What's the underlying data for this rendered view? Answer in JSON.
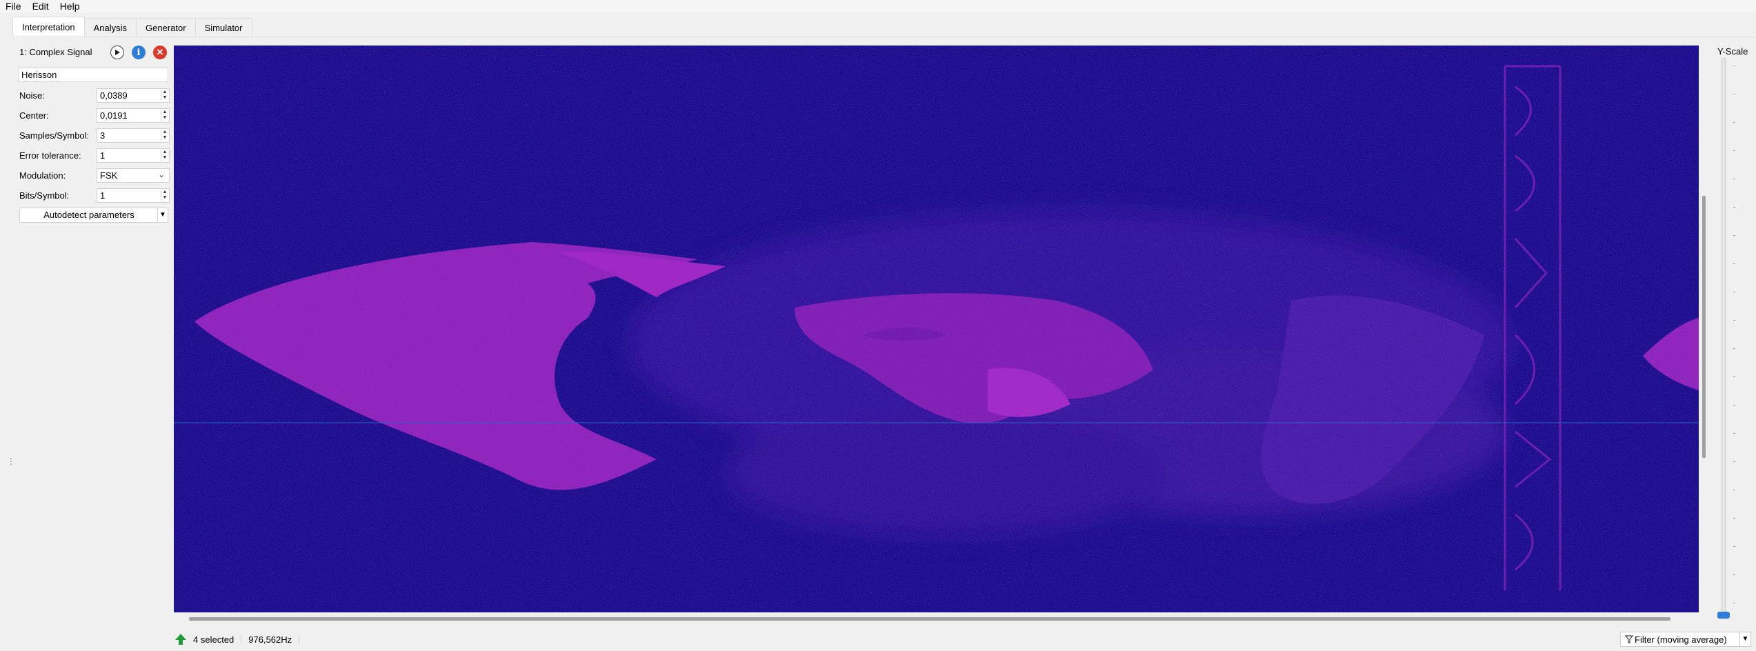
{
  "menu": [
    "File",
    "Edit",
    "Help"
  ],
  "tabs": [
    "Interpretation",
    "Analysis",
    "Generator",
    "Simulator"
  ],
  "active_tab": "Interpretation",
  "signal": {
    "index_title": "1:  Complex Signal",
    "name": "Herisson"
  },
  "params": {
    "noise_label": "Noise:",
    "noise_value": "0,0389",
    "center_label": "Center:",
    "center_value": "0,0191",
    "sps_label": "Samples/Symbol:",
    "sps_value": "3",
    "err_label": "Error tolerance:",
    "err_value": "1",
    "mod_label": "Modulation:",
    "mod_value": "FSK",
    "bits_label": "Bits/Symbol:",
    "bits_value": "1"
  },
  "autodetect_label": "Autodetect parameters",
  "yscale_label": "Y-Scale",
  "status": {
    "selected": "4  selected",
    "frequency": "976,562Hz",
    "filter": "Filter (moving average)"
  },
  "colors": {
    "spectrogram_bg": "#0e0888",
    "spectrogram_fg": "#8a1fb8",
    "accent": "#2f7bd8"
  }
}
